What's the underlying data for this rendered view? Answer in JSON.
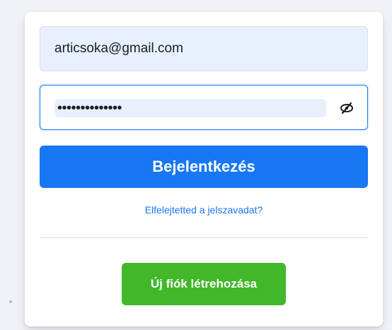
{
  "login_form": {
    "email_value": "articsoka@gmail.com",
    "password_mask": "••••••••••••••",
    "password_toggle_icon": "eye-slash-icon",
    "login_label": "Bejelentkezés",
    "forgot_password_label": "Elfelejtetted a jelszavadat?",
    "create_account_label": "Új fiók létrehozása"
  },
  "colors": {
    "primary_blue": "#1877f2",
    "create_green": "#42b72a",
    "autofill_bg": "#e8f0fe",
    "page_bg": "#f0f2f5"
  }
}
